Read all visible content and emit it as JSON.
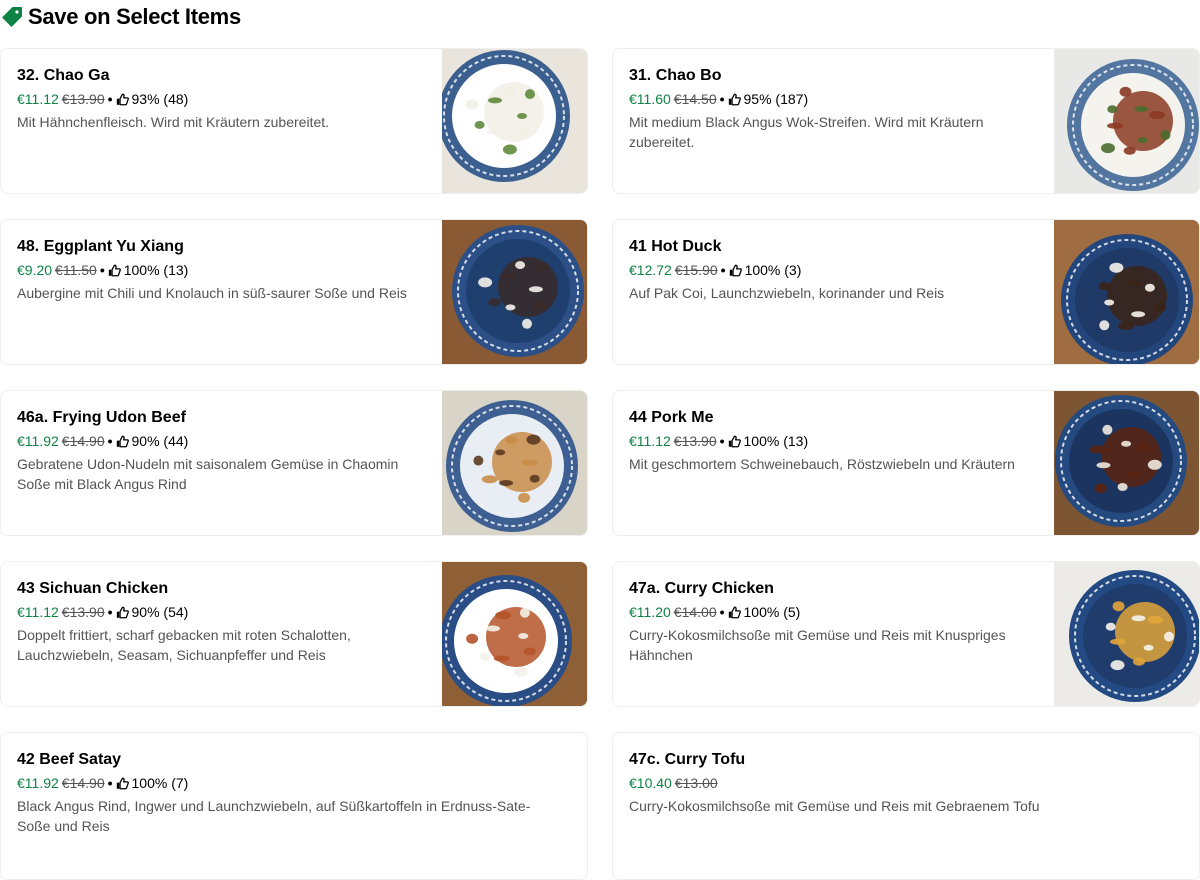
{
  "section": {
    "title": "Save on Select Items",
    "icon": "tag-icon",
    "accent_color": "#0e8345"
  },
  "items": [
    {
      "name": "32. Chao Ga",
      "price": "€11.12",
      "original_price": "€13.90",
      "rating": "93% (48)",
      "description": "Mit Hähnchenfleisch. Wird mit Kräutern zubereitet.",
      "image_bg": "#e9e4dc",
      "bowl": "#ffffff",
      "food": "#f2efe6",
      "accent": "#5f8a3b",
      "rim": "#3b5f8f"
    },
    {
      "name": "31. Chao Bo",
      "price": "€11.60",
      "original_price": "€14.50",
      "rating": "95% (187)",
      "description": "Mit medium Black Angus Wok-Streifen. Wird mit Kräutern zubereitet.",
      "image_bg": "#e8e8e6",
      "bowl": "#f5f3ee",
      "food": "#8b3a22",
      "accent": "#4a6b2e",
      "rim": "#5276a0"
    },
    {
      "name": "48. Eggplant Yu Xiang",
      "price": "€9.20",
      "original_price": "€11.50",
      "rating": "100% (13)",
      "description": "Aubergine mit Chili und Knolauch in süß-saurer Soße und Reis",
      "image_bg": "#8a5a34",
      "bowl": "#1f3f6e",
      "food": "#3a2a2a",
      "accent": "#f4f1ea",
      "rim": "#2b4f86"
    },
    {
      "name": "41 Hot Duck",
      "price": "€12.72",
      "original_price": "€15.90",
      "rating": "100% (3)",
      "description": "Auf Pak Coi, Launchzwiebeln, korinander und Reis",
      "image_bg": "#a06d42",
      "bowl": "#1f3a66",
      "food": "#3b2416",
      "accent": "#f6f3ec",
      "rim": "#23467c"
    },
    {
      "name": "46a. Frying Udon Beef",
      "price": "€11.92",
      "original_price": "€14.90",
      "rating": "90% (44)",
      "description": "Gebratene Udon-Nudeln mit saisonalem Gemüse in Chaomin Soße mit Black Angus Rind",
      "image_bg": "#d9d4c8",
      "bowl": "#e9eef4",
      "food": "#c98d48",
      "accent": "#5a3b22",
      "rim": "#3d5f92"
    },
    {
      "name": "44 Pork Me",
      "price": "€11.12",
      "original_price": "€13.90",
      "rating": "100% (13)",
      "description": "Mit geschmortem Schweinebauch, Röstzwiebeln und Kräutern",
      "image_bg": "#7e5532",
      "bowl": "#1c3560",
      "food": "#5a2412",
      "accent": "#efe9df",
      "rim": "#254a80"
    },
    {
      "name": "43 Sichuan Chicken",
      "price": "€11.12",
      "original_price": "€13.90",
      "rating": "90% (54)",
      "description": "Doppelt frittiert, scharf gebacken mit roten Schalotten, Lauchzwiebeln, Seasam, Sichuanpfeffer und Reis",
      "image_bg": "#8f5f36",
      "bowl": "#ffffff",
      "food": "#b5532a",
      "accent": "#f4f1ea",
      "rim": "#2a4d85"
    },
    {
      "name": "47a. Curry Chicken",
      "price": "€11.20",
      "original_price": "€14.00",
      "rating": "100% (5)",
      "description": "Curry-Kokosmilchsoße mit Gemüse und Reis mit Knuspriges Hähnchen",
      "image_bg": "#ecebe8",
      "bowl": "#1f3c6c",
      "food": "#e2a53a",
      "accent": "#f6f3ec",
      "rim": "#234a82"
    },
    {
      "name": "42 Beef Satay",
      "price": "€11.92",
      "original_price": "€14.90",
      "rating": "100% (7)",
      "description": "Black Angus Rind, Ingwer und Launchzwiebeln, auf Süßkartoffeln in Erdnuss-Sate- Soße und Reis"
    },
    {
      "name": "47c. Curry Tofu",
      "price": "€10.40",
      "original_price": "€13.00",
      "rating": "",
      "description": "Curry-Kokosmilchsoße mit Gemüse und Reis mit Gebraenem Tofu"
    }
  ]
}
